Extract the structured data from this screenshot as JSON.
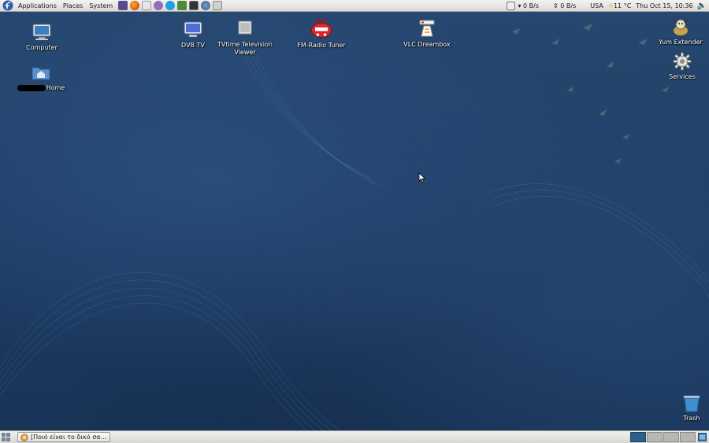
{
  "top_panel": {
    "menus": [
      {
        "label": "Applications"
      },
      {
        "label": "Places"
      },
      {
        "label": "System"
      }
    ],
    "launchers": [
      {
        "name": "launcher-app-1",
        "color": "#5a4c8c"
      },
      {
        "name": "launcher-firefox",
        "color": "#e2621b"
      },
      {
        "name": "launcher-app-3",
        "color": "#c8c8d0"
      },
      {
        "name": "launcher-app-4",
        "color": "#8f6fb5"
      },
      {
        "name": "launcher-skype",
        "color": "#1da1e2"
      },
      {
        "name": "launcher-app-6",
        "color": "#4e8a3a"
      },
      {
        "name": "launcher-terminal",
        "color": "#333333"
      },
      {
        "name": "launcher-app-8",
        "color": "#4a6e9a"
      },
      {
        "name": "launcher-app-9",
        "color": "#c9c9c9"
      }
    ],
    "tray": {
      "net1": "0 B/s",
      "net2": "0 B/s",
      "keyboard": "USA",
      "weather": "11 °C",
      "clock": "Thu Oct 15, 10:36"
    }
  },
  "desktop": {
    "icons": {
      "computer": "Computer",
      "home": "Home",
      "dvb_tv": "DVB TV",
      "tvtime": "TVtime Television Viewer",
      "fm_radio": "FM-Radio Tuner",
      "vlc": "VLC Dreambox",
      "yum": "Yum Extender",
      "services": "Services",
      "trash": "Trash"
    }
  },
  "bottom_panel": {
    "task_label": "[Ποιό είναι το δικό σα...",
    "workspaces": 4,
    "active_workspace": 1
  },
  "colors": {
    "accent": "#2e5f86",
    "desktop_bg": "#1f3b5f"
  }
}
